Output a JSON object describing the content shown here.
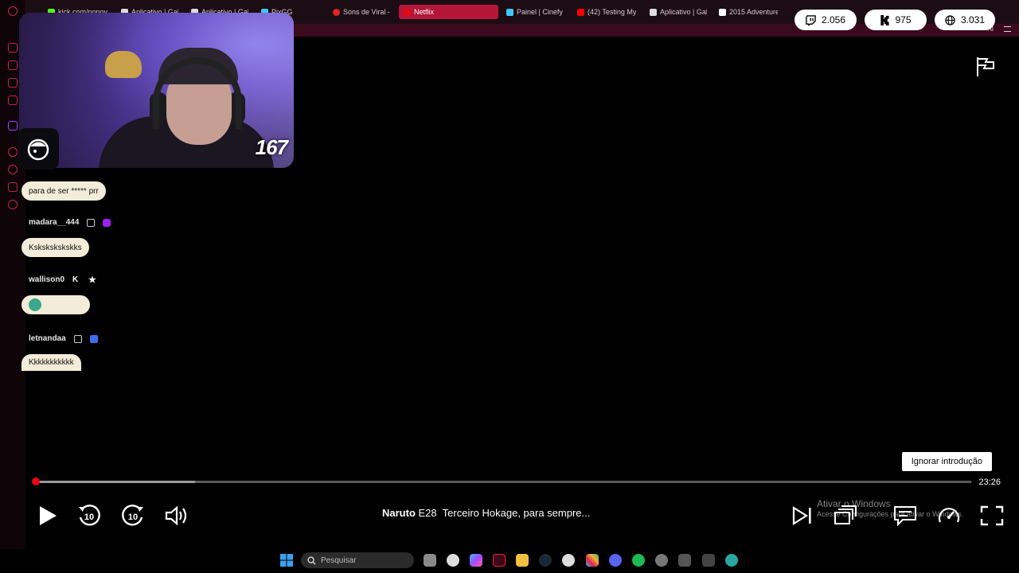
{
  "browser": {
    "tabs": [
      {
        "label": "kick.com/popov",
        "color": "#53fc18"
      },
      {
        "label": "Aplicativo | Gab",
        "color": "#ffffff"
      },
      {
        "label": "Aplicativo | Gab",
        "color": "#ffffff"
      },
      {
        "label": "PixGG",
        "color": "#42c8f5"
      },
      {
        "label": "Sons de Viral - I",
        "color": "#e02424"
      },
      {
        "label": "Netflix",
        "color": "#e50914"
      },
      {
        "label": "Painel | Cinefy",
        "color": "#42c8f5"
      },
      {
        "label": "(42) Testing My",
        "color": "#ff0000"
      },
      {
        "label": "Aplicativo | Gab",
        "color": "#ffffff"
      },
      {
        "label": "2015 Adventure",
        "color": "#ffffff"
      }
    ],
    "active_tab_index": 5,
    "toolbar_label": "AI"
  },
  "counters": {
    "twitch": "2.056",
    "kick": "975",
    "total": "3.031"
  },
  "webcam": {
    "viewer_count": "167"
  },
  "chat": {
    "messages": [
      {
        "text": "para de ser ***** prr"
      },
      {
        "user": "madara__444",
        "text": "Kskskskskskks"
      },
      {
        "user": "wallison0",
        "text": ""
      },
      {
        "user": "letnandaa",
        "text": "Kkkkkkkkkkk"
      }
    ]
  },
  "player": {
    "skip_intro": "Ignorar introdução",
    "time_remaining": "23:26",
    "progress": 0.0,
    "buffered": 0.17,
    "show": "Naruto",
    "episode": "E28",
    "episode_title": "Terceiro Hokage, para sempre...",
    "skip_back_seconds": "10",
    "skip_forward_seconds": "10"
  },
  "windows_watermark": {
    "title": "Ativar o Windows",
    "subtitle": "Acesse Configurações para ativar o Windows."
  },
  "taskbar": {
    "search_placeholder": "Pesquisar"
  },
  "colors": {
    "netflix_red": "#e50914",
    "opera_red": "#c0264a"
  }
}
